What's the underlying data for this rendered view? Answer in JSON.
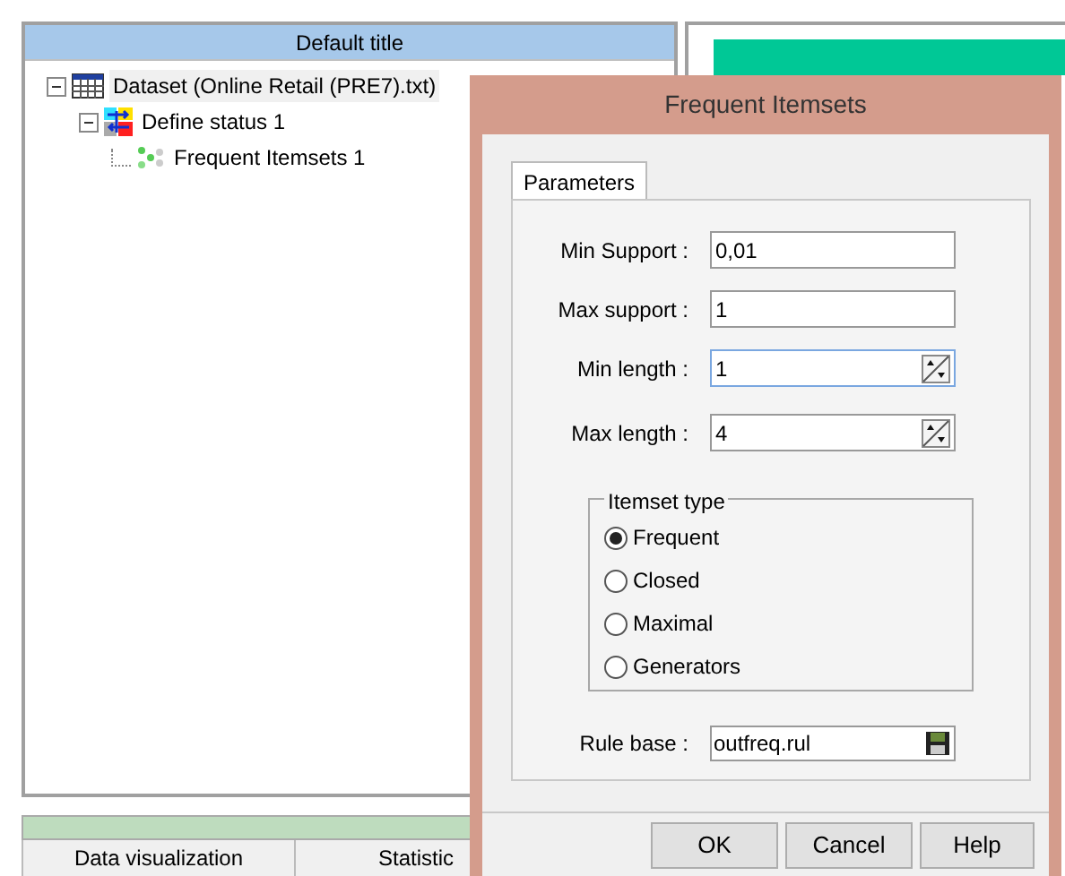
{
  "main_panel": {
    "title": "Default title",
    "tree": [
      {
        "label": "Dataset (Online Retail (PRE7).txt)",
        "kind": "dataset",
        "expanded": true,
        "selected": true,
        "children": [
          {
            "label": "Define status 1",
            "kind": "status",
            "expanded": true,
            "selected": false,
            "children": [
              {
                "label": "Frequent Itemsets 1",
                "kind": "itemsets",
                "selected": false
              }
            ]
          }
        ]
      }
    ]
  },
  "bottom_tabs": [
    {
      "label": "Data visualization"
    },
    {
      "label": "Statistic"
    }
  ],
  "dialog": {
    "title": "Frequent Itemsets",
    "tabs": [
      {
        "label": "Parameters",
        "selected": true
      }
    ],
    "fields": [
      {
        "label": "Min Support :",
        "value": "0,01",
        "kind": "text",
        "focused": false
      },
      {
        "label": "Max support :",
        "value": "1",
        "kind": "text",
        "focused": false
      },
      {
        "label": "Min length :",
        "value": "1",
        "kind": "spin",
        "focused": true
      },
      {
        "label": "Max length :",
        "value": "4",
        "kind": "spin",
        "focused": false
      }
    ],
    "itemset_type": {
      "title": "Itemset type",
      "options": [
        {
          "label": "Frequent",
          "selected": true
        },
        {
          "label": "Closed",
          "selected": false
        },
        {
          "label": "Maximal",
          "selected": false
        },
        {
          "label": "Generators",
          "selected": false
        }
      ]
    },
    "rule_base": {
      "label": "Rule base :",
      "value": "outfreq.rul"
    },
    "buttons": [
      "OK",
      "Cancel",
      "Help"
    ]
  }
}
